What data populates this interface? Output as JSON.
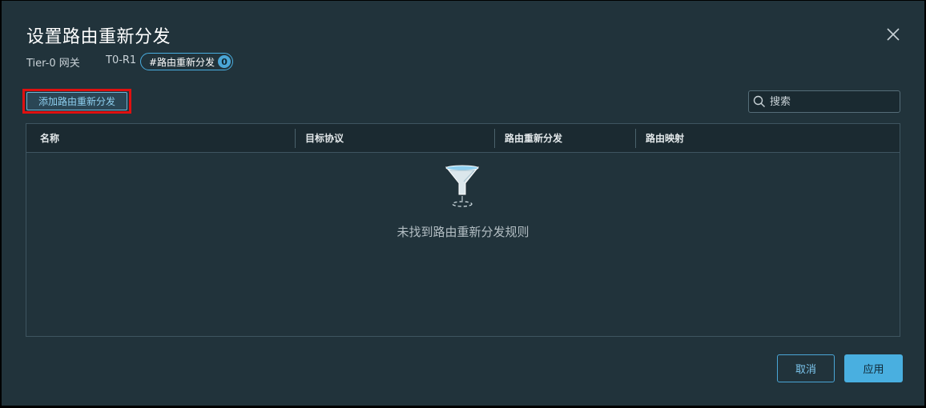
{
  "dialog": {
    "title": "设置路由重新分发",
    "close_icon": "close-icon"
  },
  "breadcrumb": {
    "gateway_type": "Tier-0 网关",
    "gateway_name": "T0-R1",
    "tag_label": "#路由重新分发",
    "tag_count": "0"
  },
  "toolbar": {
    "add_label": "添加路由重新分发",
    "search_placeholder": "搜索",
    "search_icon": "search-icon"
  },
  "table": {
    "columns": [
      "名称",
      "目标协议",
      "路由重新分发",
      "路由映射"
    ],
    "rows": [],
    "empty_icon": "funnel-filter-icon",
    "empty_message": "未找到路由重新分发规则"
  },
  "footer": {
    "cancel_label": "取消",
    "apply_label": "应用"
  },
  "colors": {
    "background": "#21333b",
    "accent": "#49afe0",
    "highlight": "#e01010"
  }
}
